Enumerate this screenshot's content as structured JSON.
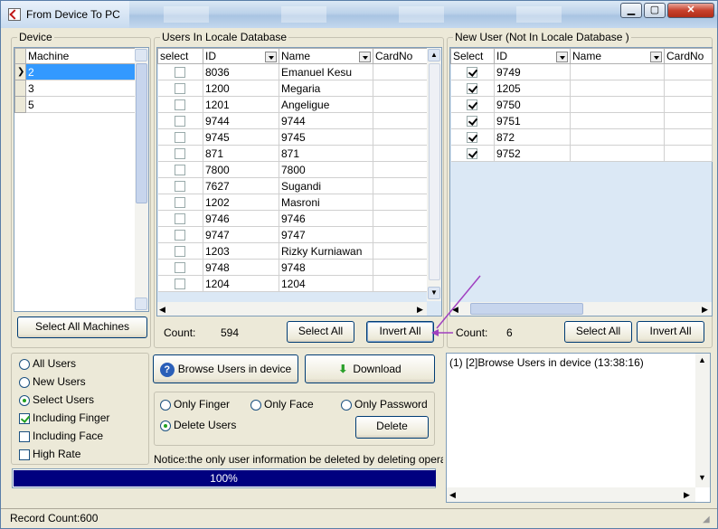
{
  "window": {
    "title": "From Device To PC"
  },
  "device": {
    "group_label": "Device",
    "column": "Machine",
    "rows": [
      "2",
      "3",
      "5"
    ],
    "select_all_label": "Select All Machines"
  },
  "locale": {
    "group_label": "Users In Locale Database",
    "columns": [
      "select",
      "ID",
      "Name",
      "CardNo"
    ],
    "rows": [
      {
        "id": "8036",
        "name": "Emanuel Kesu"
      },
      {
        "id": "1200",
        "name": "Megaria"
      },
      {
        "id": "1201",
        "name": "Angeligue"
      },
      {
        "id": "9744",
        "name": "9744"
      },
      {
        "id": "9745",
        "name": "9745"
      },
      {
        "id": "871",
        "name": "871"
      },
      {
        "id": "7800",
        "name": "7800"
      },
      {
        "id": "7627",
        "name": "Sugandi"
      },
      {
        "id": "1202",
        "name": "Masroni"
      },
      {
        "id": "9746",
        "name": "9746"
      },
      {
        "id": "9747",
        "name": "9747"
      },
      {
        "id": "1203",
        "name": "Rizky Kurniawan"
      },
      {
        "id": "9748",
        "name": "9748"
      },
      {
        "id": "1204",
        "name": "1204"
      }
    ],
    "count_label": "Count:",
    "count_value": "594",
    "select_all": "Select All",
    "invert_all": "Invert All"
  },
  "newuser": {
    "group_label": "New User (Not In Locale Database )",
    "columns": [
      "Select",
      "ID",
      "Name",
      "CardNo"
    ],
    "rows": [
      {
        "id": "9749"
      },
      {
        "id": "1205"
      },
      {
        "id": "9750"
      },
      {
        "id": "9751"
      },
      {
        "id": "872"
      },
      {
        "id": "9752"
      }
    ],
    "count_label": "Count:",
    "count_value": "6",
    "select_all": "Select All",
    "invert_all": "Invert All"
  },
  "options": {
    "all_users": "All Users",
    "new_users": "New Users",
    "select_users": "Select Users",
    "including_finger": "Including Finger",
    "including_face": "Including Face",
    "high_rate": "High Rate"
  },
  "actions": {
    "browse": "Browse Users in device",
    "download": "Download",
    "only_finger": "Only Finger",
    "only_face": "Only Face",
    "only_password": "Only Password",
    "delete_users": "Delete Users",
    "delete": "Delete",
    "notice": "Notice:the only user information  be deleted by deleting operat",
    "progress_text": "100%",
    "progress": 1.0
  },
  "log": {
    "line": "(1) [2]Browse Users in device (13:38:16)"
  },
  "status": {
    "record_count": "Record Count:600"
  },
  "colors": {
    "progress_fill": "#00007f",
    "selection": "#3399ff",
    "accent_arrow": "#a040c0"
  }
}
